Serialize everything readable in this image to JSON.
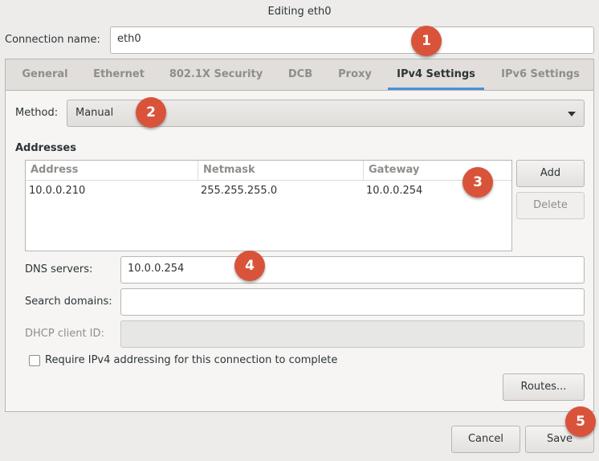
{
  "window": {
    "title": "Editing eth0"
  },
  "connection": {
    "label": "Connection name:",
    "value": "eth0"
  },
  "tabs": [
    {
      "label": "General"
    },
    {
      "label": "Ethernet"
    },
    {
      "label": "802.1X Security"
    },
    {
      "label": "DCB"
    },
    {
      "label": "Proxy"
    },
    {
      "label": "IPv4 Settings",
      "active": true
    },
    {
      "label": "IPv6 Settings"
    }
  ],
  "ipv4": {
    "method_label": "Method:",
    "method_value": "Manual",
    "addresses_heading": "Addresses",
    "columns": [
      "Address",
      "Netmask",
      "Gateway"
    ],
    "rows": [
      {
        "address": "10.0.0.210",
        "netmask": "255.255.255.0",
        "gateway": "10.0.0.254"
      }
    ],
    "add_label": "Add",
    "delete_label": "Delete",
    "dns_label": "DNS servers:",
    "dns_value": "10.0.0.254",
    "search_label": "Search domains:",
    "search_value": "",
    "dhcp_label": "DHCP client ID:",
    "dhcp_value": "",
    "require_label": "Require IPv4 addressing for this connection to complete",
    "require_checked": false,
    "routes_label": "Routes..."
  },
  "footer": {
    "cancel_label": "Cancel",
    "save_label": "Save"
  },
  "callouts": [
    "1",
    "2",
    "3",
    "4",
    "5"
  ],
  "colors": {
    "accent": "#4a90d9",
    "callout": "#d9533a"
  }
}
